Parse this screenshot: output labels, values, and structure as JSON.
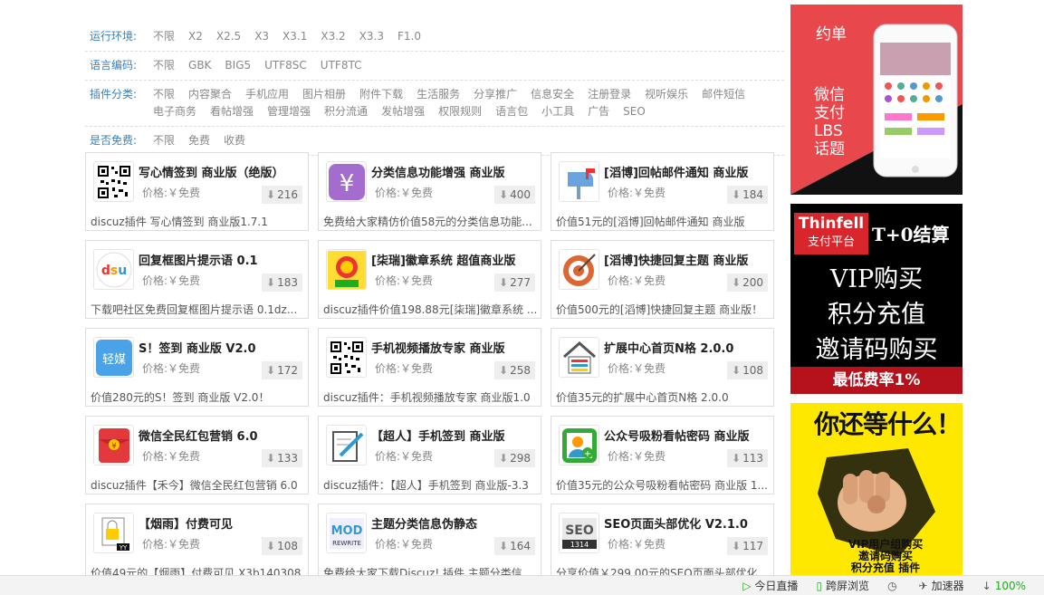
{
  "filters": [
    {
      "label": "运行环境:",
      "options": [
        "不限",
        "X2",
        "X2.5",
        "X3",
        "X3.1",
        "X3.2",
        "X3.3",
        "F1.0"
      ]
    },
    {
      "label": "语言编码:",
      "options": [
        "不限",
        "GBK",
        "BIG5",
        "UTF8SC",
        "UTF8TC"
      ]
    },
    {
      "label": "插件分类:",
      "options": [
        "不限",
        "内容聚合",
        "手机应用",
        "图片相册",
        "附件下载",
        "生活服务",
        "分享推广",
        "信息安全",
        "注册登录",
        "视听娱乐",
        "邮件短信",
        "电子商务",
        "看帖增强",
        "管理增强",
        "积分流通",
        "发帖增强",
        "权限规则",
        "语言包",
        "小工具",
        "广告",
        "SEO"
      ]
    },
    {
      "label": "是否免费:",
      "options": [
        "不限",
        "免费",
        "收费"
      ]
    }
  ],
  "price_label": "价格:￥免费",
  "download_arrow": "⬇",
  "cards": [
    {
      "title": "写心情签到 商业版（绝版）",
      "downloads": "216",
      "desc": "discuz插件 写心情签到 商业版1.7.1",
      "icon": "qr-code-icon"
    },
    {
      "title": "分类信息功能增强 商业版",
      "downloads": "400",
      "desc": "免费给大家精仿价值58元的分类信息功能...",
      "icon": "yen-icon"
    },
    {
      "title": "[滔博]回帖邮件通知 商业版",
      "downloads": "184",
      "desc": "价值51元的[滔博]回帖邮件通知 商业版",
      "icon": "mailbox-icon"
    },
    {
      "title": "回复框图片提示语 0.1",
      "downloads": "183",
      "desc": "下载吧社区免费回复框图片提示语 0.1dz...",
      "icon": "dsu-logo-icon"
    },
    {
      "title": "[柒瑞]徽章系统 超值商业版",
      "downloads": "277",
      "desc": "discuz插件价值198.88元[柒瑞]徽章系统 ...",
      "icon": "badge-icon"
    },
    {
      "title": "[滔博]快捷回复主题 商业版",
      "downloads": "200",
      "desc": "价值500元的[滔博]快捷回复主题 商业版！",
      "icon": "target-icon"
    },
    {
      "title": "S！签到 商业版 V2.0",
      "downloads": "172",
      "desc": "价值280元的S！签到 商业版 V2.0！",
      "icon": "qingmei-icon"
    },
    {
      "title": "手机视频播放专家 商业版",
      "downloads": "258",
      "desc": "discuz插件：手机视频播放专家 商业版1.0",
      "icon": "qr-code-icon"
    },
    {
      "title": "扩展中心首页N格 2.0.0",
      "downloads": "108",
      "desc": "价值35元的扩展中心首页N格 2.0.0",
      "icon": "house-icon"
    },
    {
      "title": "微信全民红包营销 6.0",
      "downloads": "133",
      "desc": "discuz插件【禾今】微信全民红包营销 6.0",
      "icon": "red-envelope-icon"
    },
    {
      "title": "【超人】手机签到 商业版",
      "downloads": "298",
      "desc": "discuz插件：【超人】手机签到 商业版-3.3",
      "icon": "sign-pen-icon"
    },
    {
      "title": "公众号吸粉看帖密码 商业版",
      "downloads": "113",
      "desc": "价值35元的公众号吸粉看帖密码 商业版 1...",
      "icon": "add-user-icon"
    },
    {
      "title": "【烟雨】付费可见",
      "downloads": "108",
      "desc": "价值49元的【烟雨】付费可见 X3b140308",
      "icon": "lock-doc-icon"
    },
    {
      "title": "主题分类信息伪静态",
      "downloads": "164",
      "desc": "免费给大家下载Discuz! 插件 主题分类信...",
      "icon": "mod-rewrite-icon"
    },
    {
      "title": "SEO页面头部优化 V2.1.0",
      "downloads": "117",
      "desc": "分享价值￥299.00元的SEO页面头部优化...",
      "icon": "seo-icon"
    }
  ],
  "ads": {
    "ad1": {
      "tag": "约单",
      "lines": [
        "微信",
        "支付",
        "LBS",
        "话题"
      ]
    },
    "ad2": {
      "brand": "Thinfell",
      "sub": "支付平台",
      "right": "T+0结算",
      "lines": [
        "VIP购买",
        "积分充值",
        "邀请码购买"
      ],
      "footer": "最低费率1%"
    },
    "ad3": {
      "headline": "你还等什么！",
      "lines": [
        "VIP用户组购买",
        "邀请码购买",
        "积分充值 插件"
      ]
    }
  },
  "statusbar": [
    {
      "icon": "play-icon",
      "label": "今日直播"
    },
    {
      "icon": "phone-icon",
      "label": "跨屏浏览"
    },
    {
      "icon": "history-icon",
      "label": ""
    },
    {
      "icon": "accelerator-icon",
      "label": "加速器"
    },
    {
      "icon": "download-icon",
      "label": "100%"
    }
  ]
}
